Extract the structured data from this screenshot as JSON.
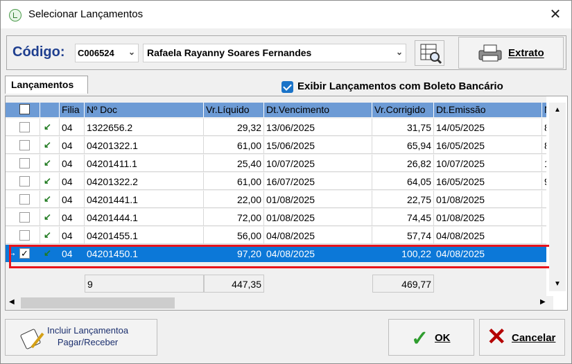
{
  "window": {
    "title": "Selecionar Lançamentos",
    "close": "✕"
  },
  "header": {
    "code_label": "Código:",
    "code_value": "C006524",
    "name_value": "Rafaela Rayanny Soares Fernandes",
    "extrato_label": "Extrato"
  },
  "tab": {
    "label": "Lançamentos"
  },
  "option": {
    "label": "Exibir Lançamentos com Boleto Bancário",
    "checked": true
  },
  "grid": {
    "columns": [
      "Filia",
      "Nº Doc",
      "Vr.Líquido",
      "Dt.Vencimento",
      "Vr.Corrigido",
      "Dt.Emissão",
      "N"
    ],
    "rows": [
      {
        "filial": "04",
        "doc": "1322656.2",
        "liquido": "29,32",
        "vencimento": "13/06/2025",
        "corrigido": "31,75",
        "emissao": "14/05/2025",
        "n": "8"
      },
      {
        "filial": "04",
        "doc": "04201322.1",
        "liquido": "61,00",
        "vencimento": "15/06/2025",
        "corrigido": "65,94",
        "emissao": "16/05/2025",
        "n": "8"
      },
      {
        "filial": "04",
        "doc": "04201411.1",
        "liquido": "25,40",
        "vencimento": "10/07/2025",
        "corrigido": "26,82",
        "emissao": "10/07/2025",
        "n": "1"
      },
      {
        "filial": "04",
        "doc": "04201322.2",
        "liquido": "61,00",
        "vencimento": "16/07/2025",
        "corrigido": "64,05",
        "emissao": "16/05/2025",
        "n": "9"
      },
      {
        "filial": "04",
        "doc": "04201441.1",
        "liquido": "22,00",
        "vencimento": "01/08/2025",
        "corrigido": "22,75",
        "emissao": "01/08/2025",
        "n": ""
      },
      {
        "filial": "04",
        "doc": "04201444.1",
        "liquido": "72,00",
        "vencimento": "01/08/2025",
        "corrigido": "74,45",
        "emissao": "01/08/2025",
        "n": ""
      },
      {
        "filial": "04",
        "doc": "04201455.1",
        "liquido": "56,00",
        "vencimento": "04/08/2025",
        "corrigido": "57,74",
        "emissao": "04/08/2025",
        "n": ""
      },
      {
        "filial": "04",
        "doc": "04201450.1",
        "liquido": "97,20",
        "vencimento": "04/08/2025",
        "corrigido": "100,22",
        "emissao": "04/08/2025",
        "n": ""
      }
    ],
    "totals": {
      "count": "9",
      "liquido": "447,35",
      "corrigido": "469,77"
    }
  },
  "footer": {
    "incluir_line1": "Incluir Lançamentoa",
    "incluir_line2": "Pagar/Receber",
    "ok_label": "OK",
    "cancel_label": "Cancelar"
  }
}
